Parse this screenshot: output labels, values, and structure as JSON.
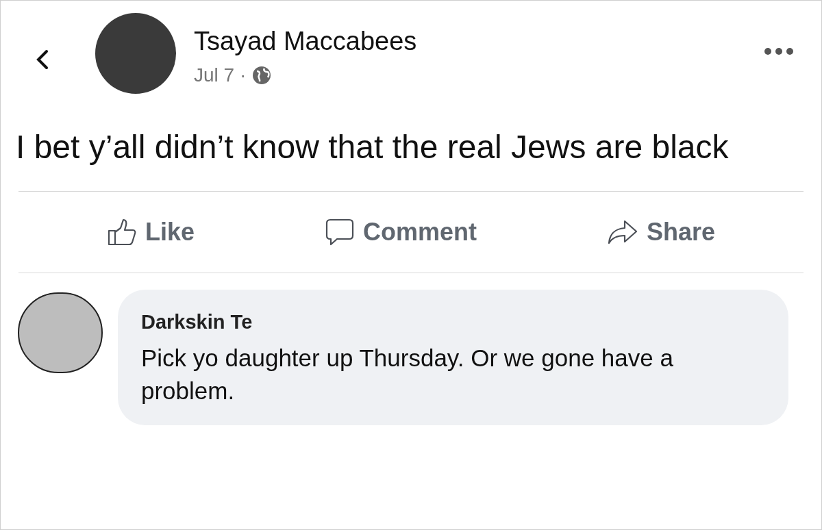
{
  "post": {
    "author": "Tsayad Maccabees",
    "date": "Jul 7 ·",
    "text": "I bet y’all didn’t know that the real Jews are black"
  },
  "actions": [
    {
      "kind": "like",
      "label": "Like"
    },
    {
      "kind": "comment",
      "label": "Comment"
    },
    {
      "kind": "share",
      "label": "Share"
    }
  ],
  "comment": {
    "author": "Darkskin Te",
    "text": "Pick yo daughter up Thursday. Or we gone have a problem."
  }
}
